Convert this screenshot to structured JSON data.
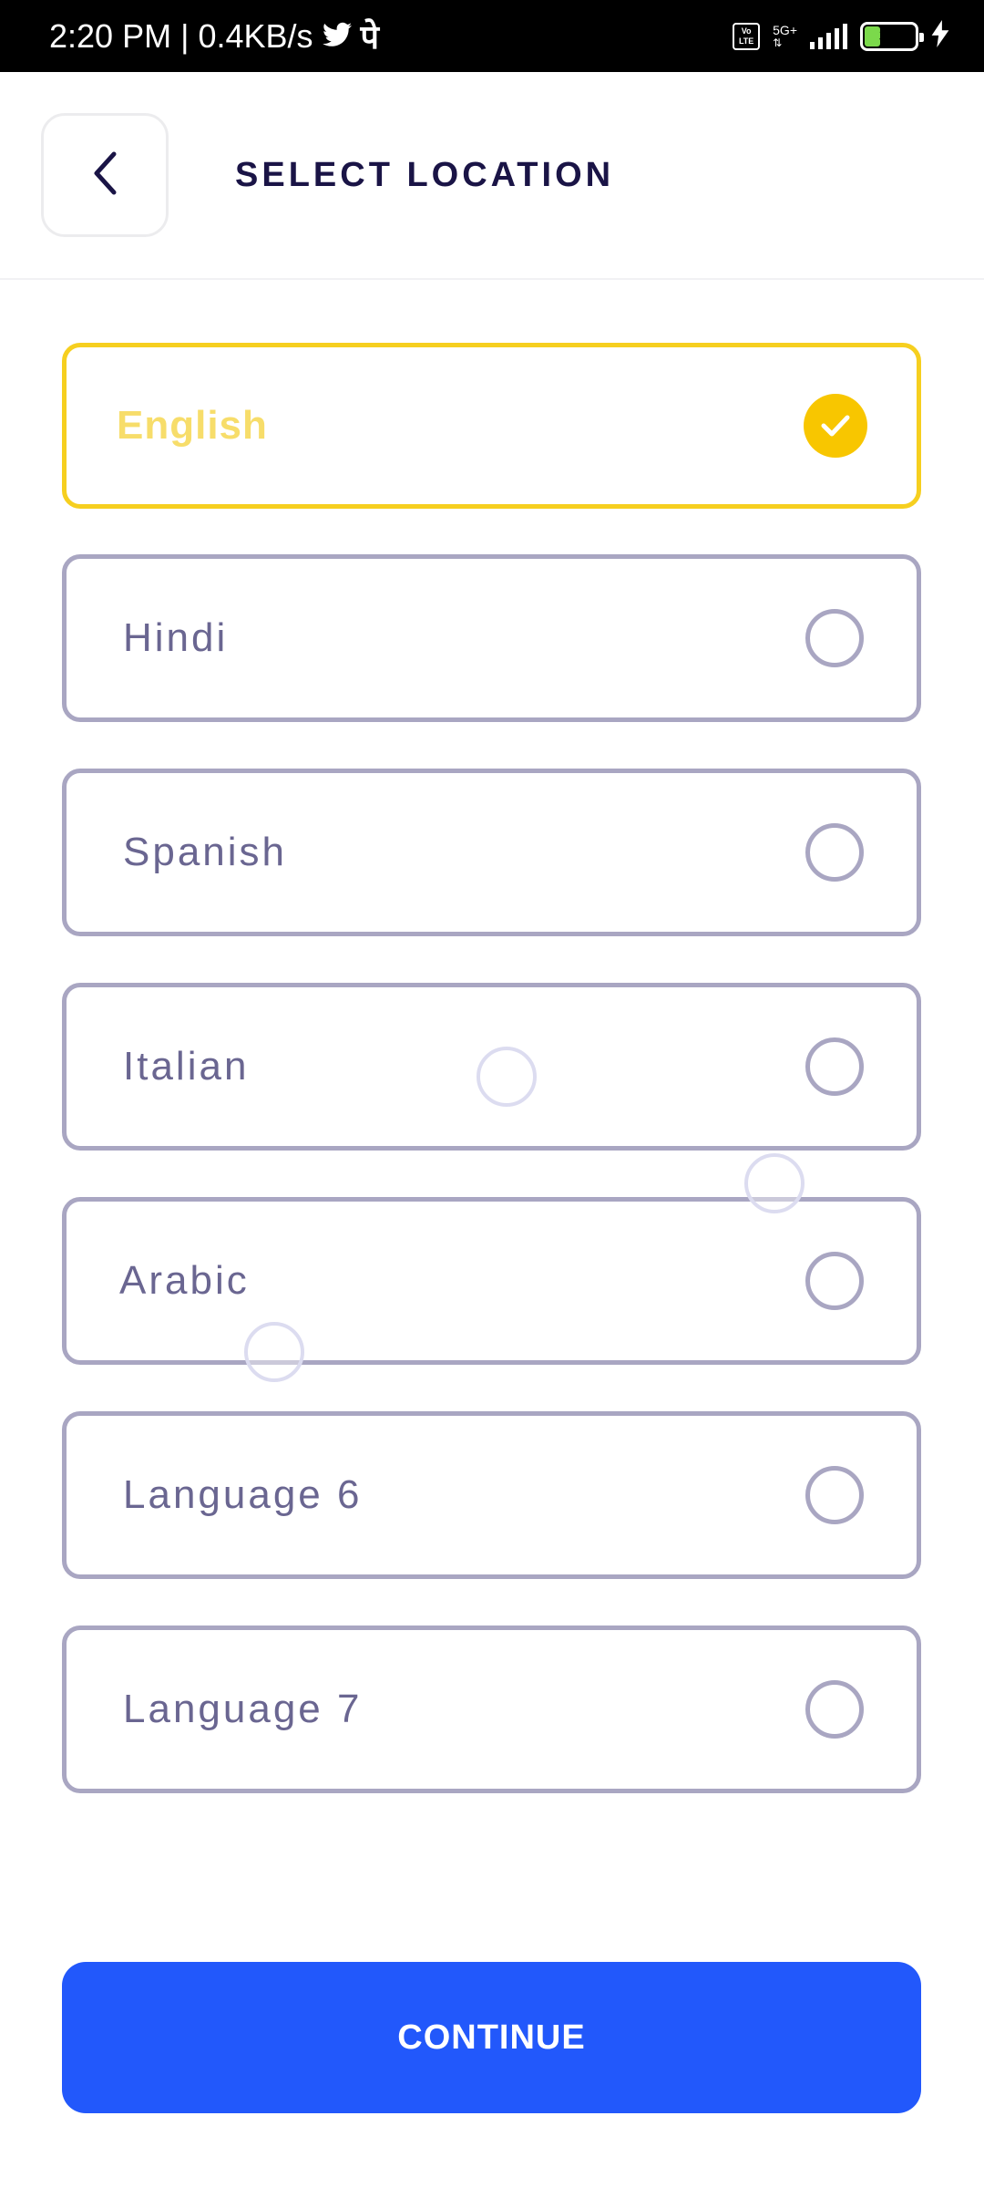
{
  "status_bar": {
    "time": "2:20 PM",
    "separator": "|",
    "speed": "0.4KB/s",
    "extra_glyph": "पे",
    "volte_line1": "Vo",
    "volte_line2": "LTE",
    "network": "5G+",
    "battery": "31",
    "icons": [
      "twitter-icon",
      "volte-icon",
      "signal-icon",
      "battery-icon",
      "charging-icon"
    ]
  },
  "header": {
    "title": "SELECT LOCATION",
    "back_icon": "chevron-left-icon"
  },
  "options": [
    {
      "label": "English",
      "selected": true
    },
    {
      "label": "Hindi",
      "selected": false
    },
    {
      "label": "Spanish",
      "selected": false
    },
    {
      "label": "Italian",
      "selected": false
    },
    {
      "label": "Arabic",
      "selected": false
    },
    {
      "label": "Language 6",
      "selected": false
    },
    {
      "label": "Language 7",
      "selected": false
    }
  ],
  "continue_label": "CONTINUE",
  "colors": {
    "accent_yellow": "#f8c600",
    "primary_blue": "#2258fb",
    "border_gray": "#a9a6c2",
    "title_navy": "#1a1446"
  }
}
